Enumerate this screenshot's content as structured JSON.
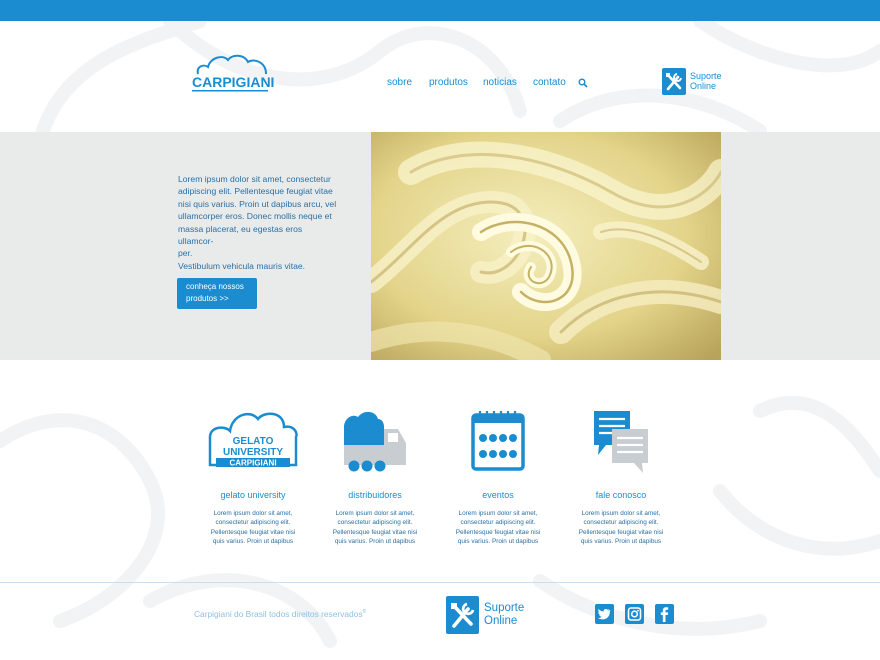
{
  "brand": {
    "name": "CARPIGIANI"
  },
  "nav": {
    "items": [
      "sobre",
      "produtos",
      "noticias",
      "contato"
    ],
    "search_icon": "search-icon"
  },
  "support": {
    "line1": "Suporte",
    "line2": "Online",
    "icon": "tools-icon"
  },
  "hero": {
    "text_lines": [
      "Lorem ipsum dolor sit amet, consectetur",
      "adipiscing elit. Pellentesque feugiat vitae",
      "nisi quis varius. Proin ut dapibus arcu, vel",
      "ullamcorper eros. Donec mollis neque et",
      "massa placerat, eu egestas eros ullamcor-",
      "per.",
      "Vestibulum vehicula mauris vitae."
    ],
    "button_lines": [
      "conheça nossos",
      "produtos >>"
    ]
  },
  "features": [
    {
      "title": "gelato university",
      "icon": "gelato-university-logo-icon",
      "logo_text": [
        "GELATO",
        "UNIVERSITY",
        "CARPIGIANI"
      ],
      "desc": [
        "Lorem ipsum dolor sit amet,",
        "consectetur adipiscing elit.",
        "Pellentesque feugiat vitae nisi",
        "quis varius. Proin ut dapibus"
      ]
    },
    {
      "title": "distribuidores",
      "icon": "delivery-truck-icon",
      "desc": [
        "Lorem ipsum dolor sit amet,",
        "consectetur adipiscing elit.",
        "Pellentesque feugiat vitae nisi",
        "quis varius. Proin ut dapibus"
      ]
    },
    {
      "title": "eventos",
      "icon": "calendar-icon",
      "desc": [
        "Lorem ipsum dolor sit amet,",
        "consectetur adipiscing elit.",
        "Pellentesque feugiat vitae nisi",
        "quis varius. Proin ut dapibus"
      ]
    },
    {
      "title": "fale conosco",
      "icon": "chat-bubbles-icon",
      "desc": [
        "Lorem ipsum dolor sit amet,",
        "consectetur adipiscing elit.",
        "Pellentesque feugiat vitae nisi",
        "quis varius. Proin ut dapibus"
      ]
    }
  ],
  "footer": {
    "copyright": "Carpigiani do Brasil todos direitos reservados",
    "copyright_mark": "®",
    "support_line1": "Suporte",
    "support_line2": "Online",
    "social": [
      "twitter-icon",
      "instagram-icon",
      "facebook-icon"
    ]
  },
  "colors": {
    "brand_blue": "#1a8ccf",
    "hero_bg": "#e9ebeb",
    "text_blue": "#2a6fa3",
    "footer_text": "#8fbfe0"
  }
}
